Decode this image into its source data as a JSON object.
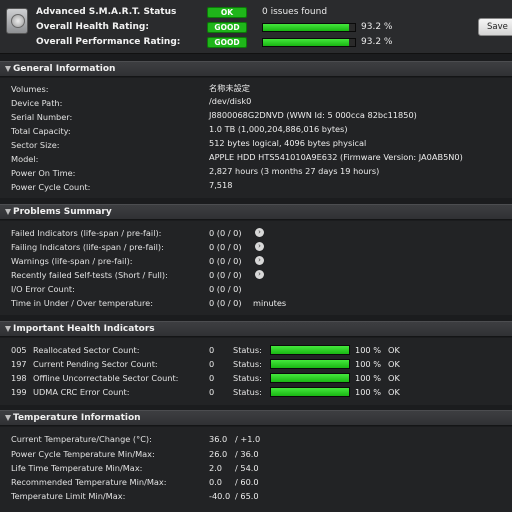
{
  "header": {
    "rows": [
      {
        "label": "Advanced S.M.A.R.T. Status",
        "badge": "OK",
        "text": "0 issues found"
      },
      {
        "label": "Overall Health Rating:",
        "badge": "GOOD",
        "percent_text": "93.2 %",
        "percent": 93.2
      },
      {
        "label": "Overall Performance Rating:",
        "badge": "GOOD",
        "percent_text": "93.2 %",
        "percent": 93.2
      }
    ],
    "save_label": "Save"
  },
  "general": {
    "title": "General Information",
    "rows": [
      {
        "label": "Volumes:",
        "value": "名称未設定"
      },
      {
        "label": "Device Path:",
        "value": "/dev/disk0"
      },
      {
        "label": "Serial Number:",
        "value": "J8800068G2DNVD (WWN Id: 5 000cca 82bc11850)"
      },
      {
        "label": "Total Capacity:",
        "value": "1.0 TB (1,000,204,886,016 bytes)"
      },
      {
        "label": "Sector Size:",
        "value": "512 bytes logical, 4096 bytes physical"
      },
      {
        "label": "Model:",
        "value": "APPLE HDD HTS541010A9E632  (Firmware Version: JA0AB5N0)"
      },
      {
        "label": "Power On Time:",
        "value": "2,827 hours (3 months 27 days 19 hours)"
      },
      {
        "label": "Power Cycle Count:",
        "value": "7,518"
      }
    ]
  },
  "problems": {
    "title": "Problems Summary",
    "rows": [
      {
        "label": "Failed Indicators (life-span / pre-fail):",
        "value": "0 (0 / 0)"
      },
      {
        "label": "Failing Indicators (life-span / pre-fail):",
        "value": "0 (0 / 0)"
      },
      {
        "label": "Warnings (life-span / pre-fail):",
        "value": "0 (0 / 0)"
      },
      {
        "label": "Recently failed Self-tests (Short / Full):",
        "value": "0 (0 / 0)"
      },
      {
        "label": "I/O Error Count:",
        "value": "0 (0 / 0)"
      },
      {
        "label": "Time in Under / Over temperature:",
        "value": "0 (0 / 0)",
        "unit": "minutes"
      }
    ]
  },
  "health": {
    "title": "Important Health Indicators",
    "status_label": "Status:",
    "rows": [
      {
        "id": "005",
        "label": "Reallocated Sector Count:",
        "value": "0",
        "percent": 100,
        "percent_text": "100 %",
        "state": "OK"
      },
      {
        "id": "197",
        "label": "Current Pending Sector Count:",
        "value": "0",
        "percent": 100,
        "percent_text": "100 %",
        "state": "OK"
      },
      {
        "id": "198",
        "label": "Offline Uncorrectable Sector Count:",
        "value": "0",
        "percent": 100,
        "percent_text": "100 %",
        "state": "OK"
      },
      {
        "id": "199",
        "label": "UDMA CRC Error Count:",
        "value": "0",
        "percent": 100,
        "percent_text": "100 %",
        "state": "OK"
      }
    ]
  },
  "temperature": {
    "title": "Temperature Information",
    "rows": [
      {
        "label": "Current Temperature/Change (°C):",
        "value": "36.0",
        "value2": "/ +1.0"
      },
      {
        "label": "Power Cycle Temperature Min/Max:",
        "value": "26.0",
        "value2": "/ 36.0"
      },
      {
        "label": "Life Time Temperature Min/Max:",
        "value": "2.0",
        "value2": "/ 54.0"
      },
      {
        "label": "Recommended Temperature Min/Max:",
        "value": "0.0",
        "value2": "/ 60.0"
      },
      {
        "label": "Temperature Limit Min/Max:",
        "value": "-40.0",
        "value2": "/ 65.0"
      }
    ]
  },
  "colors": {
    "ok_green": "#1fb51a",
    "bar_green": "#33d42c",
    "background": "#1b1c1e"
  }
}
